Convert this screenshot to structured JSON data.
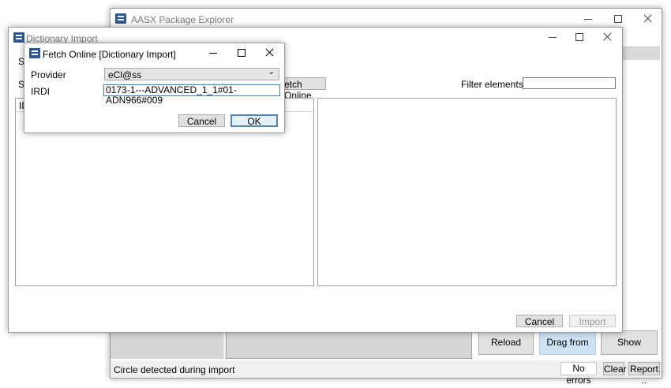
{
  "main_window": {
    "title": "AASX Package Explorer",
    "buttons": {
      "reload": "Reload",
      "drag_from_here": "Drag from here!",
      "show_content": "Show Content",
      "clear": "Clear",
      "report": "Report .."
    },
    "status": {
      "message": "Circle detected during import",
      "errors": "No errors"
    }
  },
  "dictionary_dialog": {
    "title": "Dictionary Import",
    "partial_labels": {
      "top": "Su",
      "source": "So",
      "list_header": "ID"
    },
    "fetch_online_button": "etch Online",
    "filter_label": "Filter elements:",
    "filter_value": "",
    "cancel_label": "Cancel",
    "import_label": "Import"
  },
  "fetch_dialog": {
    "title": "Fetch Online [Dictionary Import]",
    "provider_label": "Provider",
    "provider_value": "eCl@ss",
    "irdi_label": "IRDI",
    "irdi_value": "0173-1---ADVANCED_1_1#01-ADN966#009",
    "cancel_label": "Cancel",
    "ok_label": "OK"
  }
}
